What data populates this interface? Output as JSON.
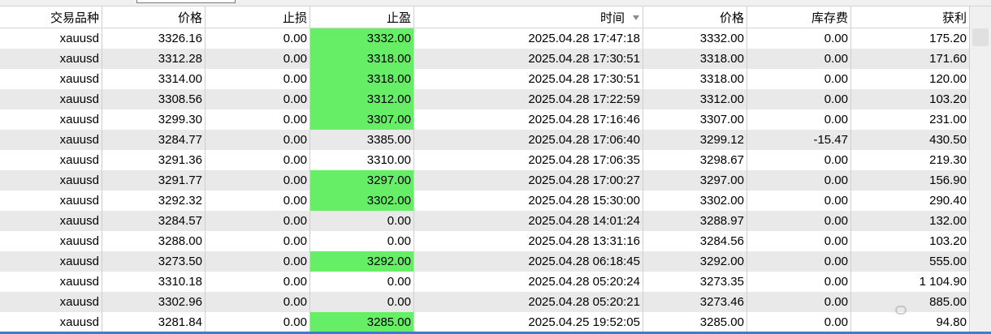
{
  "columns": [
    "交易品种",
    "价格",
    "止损",
    "止盈",
    "时间",
    "价格",
    "库存费",
    "获利"
  ],
  "sort_icon": "sort-descending-icon",
  "colors": {
    "tp_highlight": "#66ee66",
    "alt_row": "#e9e9e9"
  },
  "rows": [
    {
      "symbol": "xauusd",
      "open_price": "3326.16",
      "sl": "0.00",
      "tp": "3332.00",
      "tp_hit": true,
      "time": "2025.04.28 17:47:18",
      "close_price": "3332.00",
      "swap": "0.00",
      "profit": "175.20"
    },
    {
      "symbol": "xauusd",
      "open_price": "3312.28",
      "sl": "0.00",
      "tp": "3318.00",
      "tp_hit": true,
      "time": "2025.04.28 17:30:51",
      "close_price": "3318.00",
      "swap": "0.00",
      "profit": "171.60"
    },
    {
      "symbol": "xauusd",
      "open_price": "3314.00",
      "sl": "0.00",
      "tp": "3318.00",
      "tp_hit": true,
      "time": "2025.04.28 17:30:51",
      "close_price": "3318.00",
      "swap": "0.00",
      "profit": "120.00"
    },
    {
      "symbol": "xauusd",
      "open_price": "3308.56",
      "sl": "0.00",
      "tp": "3312.00",
      "tp_hit": true,
      "time": "2025.04.28 17:22:59",
      "close_price": "3312.00",
      "swap": "0.00",
      "profit": "103.20"
    },
    {
      "symbol": "xauusd",
      "open_price": "3299.30",
      "sl": "0.00",
      "tp": "3307.00",
      "tp_hit": true,
      "time": "2025.04.28 17:16:46",
      "close_price": "3307.00",
      "swap": "0.00",
      "profit": "231.00"
    },
    {
      "symbol": "xauusd",
      "open_price": "3284.77",
      "sl": "0.00",
      "tp": "3385.00",
      "tp_hit": false,
      "time": "2025.04.28 17:06:40",
      "close_price": "3299.12",
      "swap": "-15.47",
      "profit": "430.50"
    },
    {
      "symbol": "xauusd",
      "open_price": "3291.36",
      "sl": "0.00",
      "tp": "3310.00",
      "tp_hit": false,
      "time": "2025.04.28 17:06:35",
      "close_price": "3298.67",
      "swap": "0.00",
      "profit": "219.30"
    },
    {
      "symbol": "xauusd",
      "open_price": "3291.77",
      "sl": "0.00",
      "tp": "3297.00",
      "tp_hit": true,
      "time": "2025.04.28 17:00:27",
      "close_price": "3297.00",
      "swap": "0.00",
      "profit": "156.90"
    },
    {
      "symbol": "xauusd",
      "open_price": "3292.32",
      "sl": "0.00",
      "tp": "3302.00",
      "tp_hit": true,
      "time": "2025.04.28 15:30:00",
      "close_price": "3302.00",
      "swap": "0.00",
      "profit": "290.40"
    },
    {
      "symbol": "xauusd",
      "open_price": "3284.57",
      "sl": "0.00",
      "tp": "0.00",
      "tp_hit": false,
      "time": "2025.04.28 14:01:24",
      "close_price": "3288.97",
      "swap": "0.00",
      "profit": "132.00"
    },
    {
      "symbol": "xauusd",
      "open_price": "3288.00",
      "sl": "0.00",
      "tp": "0.00",
      "tp_hit": false,
      "time": "2025.04.28 13:31:16",
      "close_price": "3284.56",
      "swap": "0.00",
      "profit": "103.20"
    },
    {
      "symbol": "xauusd",
      "open_price": "3273.50",
      "sl": "0.00",
      "tp": "3292.00",
      "tp_hit": true,
      "time": "2025.04.28 06:18:45",
      "close_price": "3292.00",
      "swap": "0.00",
      "profit": "555.00"
    },
    {
      "symbol": "xauusd",
      "open_price": "3310.18",
      "sl": "0.00",
      "tp": "0.00",
      "tp_hit": false,
      "time": "2025.04.28 05:20:24",
      "close_price": "3273.35",
      "swap": "0.00",
      "profit": "1 104.90"
    },
    {
      "symbol": "xauusd",
      "open_price": "3302.96",
      "sl": "0.00",
      "tp": "0.00",
      "tp_hit": false,
      "time": "2025.04.28 05:20:21",
      "close_price": "3273.46",
      "swap": "0.00",
      "profit": "885.00"
    },
    {
      "symbol": "xauusd",
      "open_price": "3281.84",
      "sl": "0.00",
      "tp": "3285.00",
      "tp_hit": true,
      "time": "2025.04.25 19:52:05",
      "close_price": "3285.00",
      "swap": "0.00",
      "profit": "94.80"
    }
  ]
}
